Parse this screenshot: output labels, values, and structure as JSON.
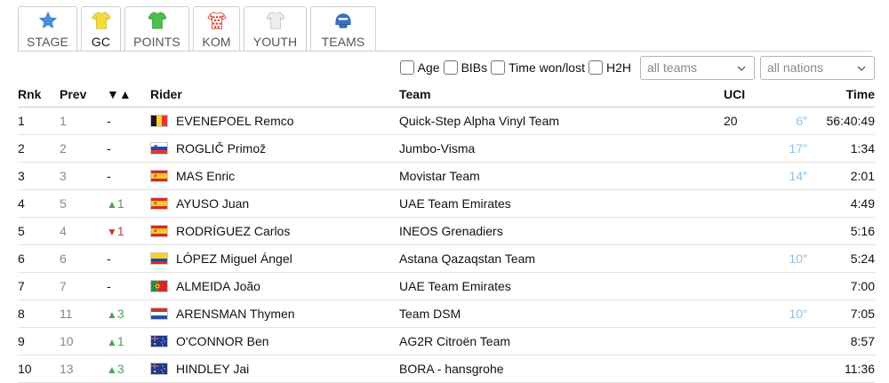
{
  "tabs": [
    {
      "label": "STAGE",
      "icon": "star-icon",
      "color": "#4a8fe0"
    },
    {
      "label": "GC",
      "icon": "jersey-icon",
      "color": "#f5e04a",
      "active": true
    },
    {
      "label": "POINTS",
      "icon": "jersey-icon",
      "color": "#4cbf4c"
    },
    {
      "label": "KOM",
      "icon": "polka-dot-jersey-icon",
      "color": "#d9342b"
    },
    {
      "label": "YOUTH",
      "icon": "jersey-icon",
      "color": "#e6e6e6"
    },
    {
      "label": "TEAMS",
      "icon": "helmet-icon",
      "color": "#3a6fc4"
    }
  ],
  "filters": {
    "checkboxes": [
      "Age",
      "BIBs",
      "Time won/lost",
      "H2H"
    ],
    "team_select": "all teams",
    "nation_select": "all nations"
  },
  "columns": {
    "rnk": "Rnk",
    "prev": "Prev",
    "change": "▼▲",
    "rider": "Rider",
    "team": "Team",
    "uci": "UCI",
    "bonus": "",
    "time": "Time"
  },
  "rows": [
    {
      "rnk": "1",
      "prev": "1",
      "change": "-",
      "dir": "none",
      "flag": "be",
      "rider": "EVENEPOEL Remco",
      "team": "Quick-Step Alpha Vinyl Team",
      "uci": "20",
      "bonus": "6″",
      "time": "56:40:49"
    },
    {
      "rnk": "2",
      "prev": "2",
      "change": "-",
      "dir": "none",
      "flag": "si",
      "rider": "ROGLIČ Primož",
      "team": "Jumbo-Visma",
      "uci": "",
      "bonus": "17″",
      "time": "1:34"
    },
    {
      "rnk": "3",
      "prev": "3",
      "change": "-",
      "dir": "none",
      "flag": "es",
      "rider": "MAS Enric",
      "team": "Movistar Team",
      "uci": "",
      "bonus": "14″",
      "time": "2:01"
    },
    {
      "rnk": "4",
      "prev": "5",
      "change": "1",
      "dir": "up",
      "flag": "es",
      "rider": "AYUSO Juan",
      "team": "UAE Team Emirates",
      "uci": "",
      "bonus": "",
      "time": "4:49"
    },
    {
      "rnk": "5",
      "prev": "4",
      "change": "1",
      "dir": "down",
      "flag": "es",
      "rider": "RODRÍGUEZ Carlos",
      "team": "INEOS Grenadiers",
      "uci": "",
      "bonus": "",
      "time": "5:16"
    },
    {
      "rnk": "6",
      "prev": "6",
      "change": "-",
      "dir": "none",
      "flag": "co",
      "rider": "LÓPEZ Miguel Ángel",
      "team": "Astana Qazaqstan Team",
      "uci": "",
      "bonus": "10″",
      "time": "5:24"
    },
    {
      "rnk": "7",
      "prev": "7",
      "change": "-",
      "dir": "none",
      "flag": "pt",
      "rider": "ALMEIDA João",
      "team": "UAE Team Emirates",
      "uci": "",
      "bonus": "",
      "time": "7:00"
    },
    {
      "rnk": "8",
      "prev": "11",
      "change": "3",
      "dir": "up",
      "flag": "nl",
      "rider": "ARENSMAN Thymen",
      "team": "Team DSM",
      "uci": "",
      "bonus": "10″",
      "time": "7:05"
    },
    {
      "rnk": "9",
      "prev": "10",
      "change": "1",
      "dir": "up",
      "flag": "au",
      "rider": "O'CONNOR Ben",
      "team": "AG2R Citroën Team",
      "uci": "",
      "bonus": "",
      "time": "8:57"
    },
    {
      "rnk": "10",
      "prev": "13",
      "change": "3",
      "dir": "up",
      "flag": "au",
      "rider": "HINDLEY Jai",
      "team": "BORA - hansgrohe",
      "uci": "",
      "bonus": "",
      "time": "11:36"
    }
  ],
  "colors": {
    "up": "#4aa64a",
    "down": "#d33a2a",
    "bonus": "#8fc3e8"
  }
}
